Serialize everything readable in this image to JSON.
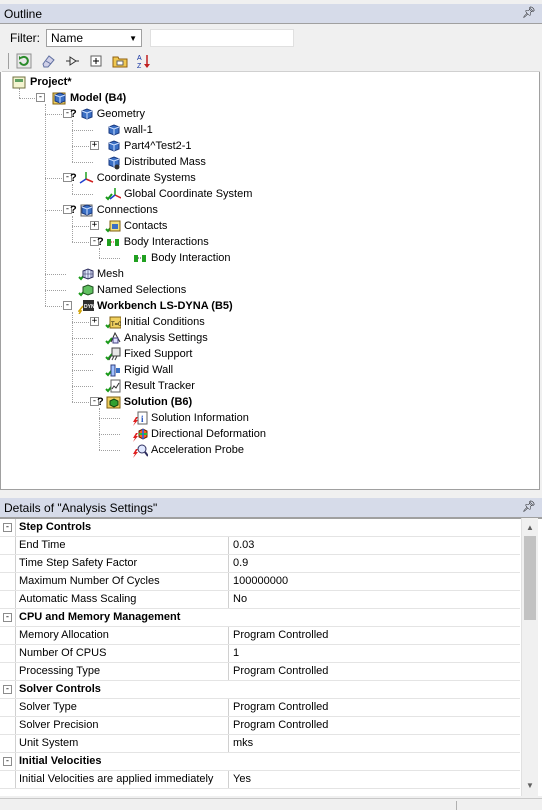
{
  "outline": {
    "title": "Outline",
    "pin": "⯒",
    "filter_label": "Filter:",
    "filter_value": "Name",
    "tree": [
      {
        "label": "Project*",
        "level": 0,
        "icon": "project-icon",
        "bold": true,
        "expander": "",
        "q": ""
      },
      {
        "label": "Model (B4)",
        "level": 1,
        "icon": "model-icon",
        "bold": true,
        "expander": "-",
        "q": ""
      },
      {
        "label": "Geometry",
        "level": 2,
        "icon": "geometry-icon",
        "bold": false,
        "expander": "-",
        "q": "?"
      },
      {
        "label": "wall-1",
        "level": 3,
        "icon": "body-icon",
        "bold": false,
        "expander": "",
        "q": ""
      },
      {
        "label": "Part4^Test2-1",
        "level": 3,
        "icon": "part-icon",
        "bold": false,
        "expander": "+",
        "q": ""
      },
      {
        "label": "Distributed Mass",
        "level": 3,
        "icon": "distributed-mass-icon",
        "bold": false,
        "expander": "",
        "q": ""
      },
      {
        "label": "Coordinate Systems",
        "level": 2,
        "icon": "coordinate-systems-icon",
        "bold": false,
        "expander": "-",
        "q": "?"
      },
      {
        "label": "Global Coordinate System",
        "level": 3,
        "icon": "coordinate-system-icon",
        "bold": false,
        "expander": "",
        "q": ""
      },
      {
        "label": "Connections",
        "level": 2,
        "icon": "connections-icon",
        "bold": false,
        "expander": "-",
        "q": "?"
      },
      {
        "label": "Contacts",
        "level": 3,
        "icon": "contacts-icon",
        "bold": false,
        "expander": "+",
        "q": ""
      },
      {
        "label": "Body Interactions",
        "level": 3,
        "icon": "body-interactions-icon",
        "bold": false,
        "expander": "-",
        "q": "?"
      },
      {
        "label": "Body Interaction",
        "level": 4,
        "icon": "body-interaction-icon",
        "bold": false,
        "expander": "",
        "q": ""
      },
      {
        "label": "Mesh",
        "level": 2,
        "icon": "mesh-icon",
        "bold": false,
        "expander": "",
        "q": ""
      },
      {
        "label": "Named Selections",
        "level": 2,
        "icon": "named-selections-icon",
        "bold": false,
        "expander": "",
        "q": ""
      },
      {
        "label": "Workbench LS-DYNA (B5)",
        "level": 2,
        "icon": "analysis-icon",
        "bold": true,
        "expander": "-",
        "q": ""
      },
      {
        "label": "Initial Conditions",
        "level": 3,
        "icon": "initial-conditions-icon",
        "bold": false,
        "expander": "+",
        "q": ""
      },
      {
        "label": "Analysis Settings",
        "level": 3,
        "icon": "analysis-settings-icon",
        "bold": false,
        "expander": "",
        "q": ""
      },
      {
        "label": "Fixed Support",
        "level": 3,
        "icon": "fixed-support-icon",
        "bold": false,
        "expander": "",
        "q": ""
      },
      {
        "label": "Rigid Wall",
        "level": 3,
        "icon": "rigid-wall-icon",
        "bold": false,
        "expander": "",
        "q": ""
      },
      {
        "label": "Result Tracker",
        "level": 3,
        "icon": "result-tracker-icon",
        "bold": false,
        "expander": "",
        "q": ""
      },
      {
        "label": "Solution (B6)",
        "level": 3,
        "icon": "solution-icon",
        "bold": true,
        "expander": "-",
        "q": "?"
      },
      {
        "label": "Solution Information",
        "level": 4,
        "icon": "solution-information-icon",
        "bold": false,
        "expander": "",
        "q": ""
      },
      {
        "label": "Directional Deformation",
        "level": 4,
        "icon": "directional-deformation-icon",
        "bold": false,
        "expander": "",
        "q": ""
      },
      {
        "label": "Acceleration Probe",
        "level": 4,
        "icon": "acceleration-probe-icon",
        "bold": false,
        "expander": "",
        "q": ""
      }
    ]
  },
  "details": {
    "title": "Details of \"Analysis Settings\"",
    "pin": "⯒",
    "rows": [
      {
        "type": "section",
        "label": "Step Controls"
      },
      {
        "type": "prop",
        "label": "End Time",
        "value": "0.03"
      },
      {
        "type": "prop",
        "label": "Time Step Safety Factor",
        "value": "0.9"
      },
      {
        "type": "prop",
        "label": "Maximum Number Of Cycles",
        "value": "100000000"
      },
      {
        "type": "prop",
        "label": "Automatic Mass Scaling",
        "value": "No"
      },
      {
        "type": "section",
        "label": "CPU and Memory Management"
      },
      {
        "type": "prop",
        "label": "Memory Allocation",
        "value": "Program Controlled"
      },
      {
        "type": "prop",
        "label": "Number Of CPUS",
        "value": "1"
      },
      {
        "type": "prop",
        "label": "Processing Type",
        "value": "Program Controlled"
      },
      {
        "type": "section",
        "label": "Solver Controls"
      },
      {
        "type": "prop",
        "label": "Solver Type",
        "value": "Program Controlled"
      },
      {
        "type": "prop",
        "label": "Solver Precision",
        "value": "Program Controlled"
      },
      {
        "type": "prop",
        "label": "Unit System",
        "value": "mks"
      },
      {
        "type": "section",
        "label": "Initial Velocities"
      },
      {
        "type": "prop",
        "label": "Initial Velocities are applied immediately",
        "value": "Yes"
      }
    ]
  },
  "colors": {
    "header_bg": "#d6dbe9",
    "check_green": "#1a9a1a",
    "bolt_red": "#e02020",
    "icon_blue": "#3a6fc4",
    "icon_yellow": "#e8c020"
  }
}
